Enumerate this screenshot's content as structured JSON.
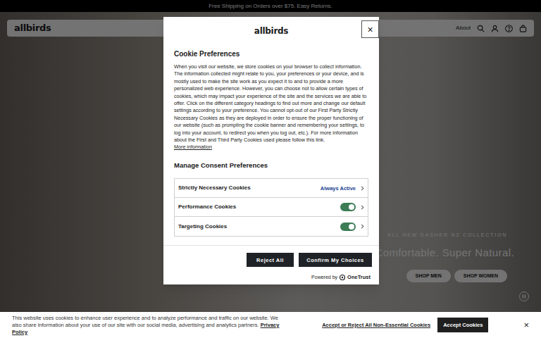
{
  "announcement": "Free Shipping on Orders over $75. Easy Returns.",
  "header": {
    "logo": "allbirds",
    "nav": [
      "About"
    ]
  },
  "hero": {
    "eyebrow": "ALL NEW DASHER NZ COLLECTION",
    "headline": "Comfortable. Super Natural.",
    "buttons": [
      "SHOP MEN",
      "SHOP WOMEN"
    ]
  },
  "modal": {
    "logo": "allbirds",
    "close": "×",
    "title": "Cookie Preferences",
    "description": "When you visit our website, we store cookies on your browser to collect information. The information collected might relate to you, your preferences or your device, and is mostly used to make the site work as you expect it to and to provide a more personalized web experience. However, you can choose not to allow certain types of cookies, which may impact your experience of the site and the services we are able to offer. Click on the different category headings to find out more and change our default settings according to your preference. You cannot opt-out of our First Party Strictly Necessary Cookies as they are deployed in order to ensure the proper functioning of our website (such as prompting the cookie banner and remembering your settings, to log into your account, to redirect you when you log out, etc.). For more information about the First and Third Party Cookies used please follow this link.",
    "more_info": "More information",
    "manage_title": "Manage Consent Preferences",
    "categories": [
      {
        "name": "Strictly Necessary Cookies",
        "kind": "status",
        "status": "Always Active"
      },
      {
        "name": "Performance Cookies",
        "kind": "toggle",
        "on": true
      },
      {
        "name": "Targeting Cookies",
        "kind": "toggle",
        "on": true
      }
    ],
    "buttons": [
      "Reject All",
      "Confirm My Choices"
    ],
    "powered_by": "Powered by",
    "powered_brand": "OneTrust"
  },
  "banner": {
    "text": "This website uses cookies to enhance user experience and to analyze performance and traffic on our website. We also share information about your use of our site with our social media, advertising and analytics partners.",
    "link": "Privacy Policy",
    "reject_link": "Accept or Reject All Non-Essential Cookies",
    "accept": "Accept Cookies",
    "close": "×"
  }
}
